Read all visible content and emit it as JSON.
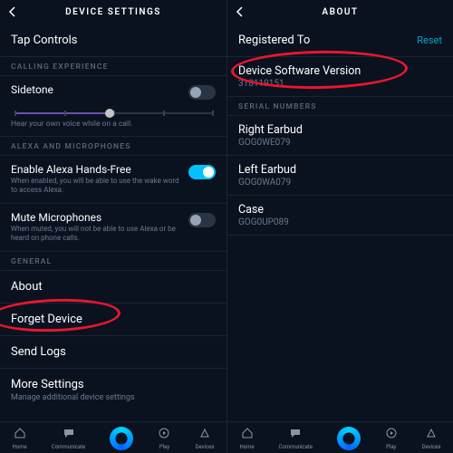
{
  "left": {
    "header_title": "DEVICE SETTINGS",
    "tap_controls": "Tap Controls",
    "section_calling": "CALLING EXPERIENCE",
    "sidetone_label": "Sidetone",
    "slider_caption": "Hear your own voice while on a call.",
    "section_alexa": "ALEXA AND MICROPHONES",
    "handsfree_label": "Enable Alexa Hands-Free",
    "handsfree_sub": "When enabled, you will be able to use the wake word to access Alexa.",
    "mute_label": "Mute Microphones",
    "mute_sub": "When muted, you will not be able to use Alexa or be heard on phone calls.",
    "section_general": "GENERAL",
    "about": "About",
    "forget": "Forget Device",
    "sendlogs": "Send Logs",
    "moresettings_label": "More Settings",
    "moresettings_sub": "Manage additional device settings"
  },
  "right": {
    "header_title": "ABOUT",
    "registered_label": "Registered To",
    "reset_link": "Reset",
    "version_label": "Device Software Version",
    "version_value": "318119151",
    "section_serial": "SERIAL NUMBERS",
    "right_earbud_label": "Right Earbud",
    "right_earbud_value": "GOG0WE079",
    "left_earbud_label": "Left Earbud",
    "left_earbud_value": "GOG0WA079",
    "case_label": "Case",
    "case_value": "GOG0UP089"
  },
  "nav": {
    "home": "Home",
    "communicate": "Communicate",
    "play": "Play",
    "devices": "Devices"
  },
  "colors": {
    "accent": "#00c2ff",
    "annotation": "#e8162e"
  }
}
